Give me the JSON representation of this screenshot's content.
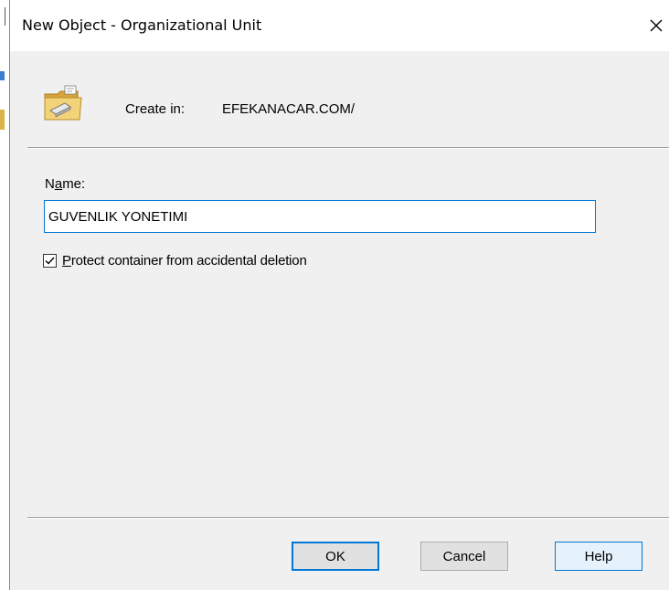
{
  "window": {
    "title": "New Object - Organizational Unit",
    "close_glyph": "✕"
  },
  "header": {
    "icon": "organizational-unit-folder-icon",
    "create_in_label": "Create in:",
    "create_in_value": "EFEKANACAR.COM/"
  },
  "form": {
    "name_label_prefix": "N",
    "name_label_underlined": "a",
    "name_label_suffix": "me:",
    "name_value": "GUVENLIK YONETIMI",
    "protect_checked": true,
    "protect_label_underlined": "P",
    "protect_label_rest": "rotect container from accidental deletion"
  },
  "buttons": {
    "ok_label": "OK",
    "cancel_label": "Cancel",
    "help_label": "Help"
  },
  "colors": {
    "focus_accent": "#0078d7",
    "dialog_background": "#f0f0f0",
    "help_hover_background": "#e5f1fb"
  }
}
